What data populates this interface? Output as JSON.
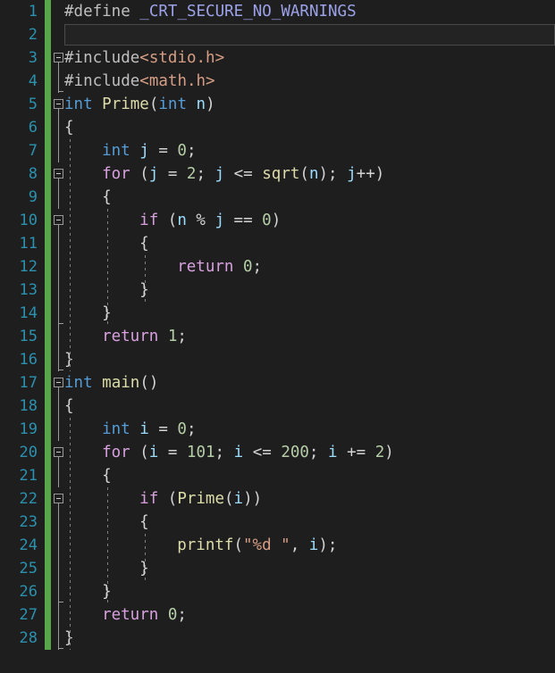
{
  "editor": {
    "name": "code-editor",
    "theme": "dark",
    "language": "c",
    "colors": {
      "background": "#1e1e1e",
      "line_number": "#2b91af",
      "change_bar": "#57a64a",
      "keyword": "#569cd6",
      "control_keyword": "#d8a0df",
      "function": "#dcdcaa",
      "number": "#b5cea8",
      "string": "#d69d85",
      "macro": "#9ca2e8",
      "preprocessor": "#bfbfbf",
      "plain": "#d4d4d4",
      "variable": "#9cdcfe",
      "current_line_border": "#4a4a4a",
      "fold_marker": "#9a9a9a"
    },
    "line_count": 28,
    "current_line": 2,
    "line_numbers": [
      "1",
      "2",
      "3",
      "4",
      "5",
      "6",
      "7",
      "8",
      "9",
      "10",
      "11",
      "12",
      "13",
      "14",
      "15",
      "16",
      "17",
      "18",
      "19",
      "20",
      "21",
      "22",
      "23",
      "24",
      "25",
      "26",
      "27",
      "28"
    ],
    "lines": [
      {
        "n": 1,
        "indent": 0,
        "fold": "none",
        "tokens": [
          {
            "t": "#define ",
            "c": "pp"
          },
          {
            "t": "_CRT_SECURE_NO_WARNINGS",
            "c": "macro"
          }
        ]
      },
      {
        "n": 2,
        "indent": 0,
        "fold": "none",
        "current": true,
        "tokens": []
      },
      {
        "n": 3,
        "indent": 0,
        "fold": "open",
        "tokens": [
          {
            "t": "#include",
            "c": "pp"
          },
          {
            "t": "<stdio.h>",
            "c": "str"
          }
        ]
      },
      {
        "n": 4,
        "indent": 0,
        "fold": "line-end",
        "tokens": [
          {
            "t": "#include",
            "c": "pp"
          },
          {
            "t": "<math.h>",
            "c": "str"
          }
        ]
      },
      {
        "n": 5,
        "indent": 0,
        "fold": "open",
        "tokens": [
          {
            "t": "int",
            "c": "kw"
          },
          {
            "t": " ",
            "c": "plain"
          },
          {
            "t": "Prime",
            "c": "fn"
          },
          {
            "t": "(",
            "c": "punct"
          },
          {
            "t": "int",
            "c": "kw"
          },
          {
            "t": " n",
            "c": "var"
          },
          {
            "t": ")",
            "c": "punct"
          }
        ]
      },
      {
        "n": 6,
        "indent": 0,
        "fold": "line",
        "tokens": [
          {
            "t": "{",
            "c": "plain"
          }
        ]
      },
      {
        "n": 7,
        "indent": 1,
        "fold": "line",
        "tokens": [
          {
            "t": "int",
            "c": "kw"
          },
          {
            "t": " ",
            "c": "plain"
          },
          {
            "t": "j",
            "c": "var"
          },
          {
            "t": " = ",
            "c": "plain"
          },
          {
            "t": "0",
            "c": "num"
          },
          {
            "t": ";",
            "c": "plain"
          }
        ]
      },
      {
        "n": 8,
        "indent": 1,
        "fold": "open",
        "tokens": [
          {
            "t": "for",
            "c": "ctrl"
          },
          {
            "t": " (",
            "c": "plain"
          },
          {
            "t": "j",
            "c": "var"
          },
          {
            "t": " = ",
            "c": "plain"
          },
          {
            "t": "2",
            "c": "num"
          },
          {
            "t": "; ",
            "c": "plain"
          },
          {
            "t": "j",
            "c": "var"
          },
          {
            "t": " <= ",
            "c": "plain"
          },
          {
            "t": "sqrt",
            "c": "fn"
          },
          {
            "t": "(",
            "c": "plain"
          },
          {
            "t": "n",
            "c": "var"
          },
          {
            "t": "); ",
            "c": "plain"
          },
          {
            "t": "j",
            "c": "var"
          },
          {
            "t": "++)",
            "c": "plain"
          }
        ]
      },
      {
        "n": 9,
        "indent": 1,
        "fold": "line",
        "tokens": [
          {
            "t": "{",
            "c": "plain"
          }
        ]
      },
      {
        "n": 10,
        "indent": 2,
        "fold": "open",
        "tokens": [
          {
            "t": "if",
            "c": "ctrl"
          },
          {
            "t": " (",
            "c": "plain"
          },
          {
            "t": "n",
            "c": "var"
          },
          {
            "t": " % ",
            "c": "plain"
          },
          {
            "t": "j",
            "c": "var"
          },
          {
            "t": " == ",
            "c": "plain"
          },
          {
            "t": "0",
            "c": "num"
          },
          {
            "t": ")",
            "c": "plain"
          }
        ]
      },
      {
        "n": 11,
        "indent": 2,
        "fold": "line",
        "tokens": [
          {
            "t": "{",
            "c": "plain"
          }
        ]
      },
      {
        "n": 12,
        "indent": 3,
        "fold": "line",
        "tokens": [
          {
            "t": "return",
            "c": "ctrl"
          },
          {
            "t": " ",
            "c": "plain"
          },
          {
            "t": "0",
            "c": "num"
          },
          {
            "t": ";",
            "c": "plain"
          }
        ]
      },
      {
        "n": 13,
        "indent": 2,
        "fold": "line",
        "tokens": [
          {
            "t": "}",
            "c": "plain"
          }
        ]
      },
      {
        "n": 14,
        "indent": 1,
        "fold": "end",
        "tokens": [
          {
            "t": "}",
            "c": "plain"
          }
        ]
      },
      {
        "n": 15,
        "indent": 1,
        "fold": "line",
        "tokens": [
          {
            "t": "return",
            "c": "ctrl"
          },
          {
            "t": " ",
            "c": "plain"
          },
          {
            "t": "1",
            "c": "num"
          },
          {
            "t": ";",
            "c": "plain"
          }
        ]
      },
      {
        "n": 16,
        "indent": 0,
        "fold": "end",
        "tokens": [
          {
            "t": "}",
            "c": "plain"
          }
        ]
      },
      {
        "n": 17,
        "indent": 0,
        "fold": "open",
        "tokens": [
          {
            "t": "int",
            "c": "kw"
          },
          {
            "t": " ",
            "c": "plain"
          },
          {
            "t": "main",
            "c": "fn"
          },
          {
            "t": "()",
            "c": "punct"
          }
        ]
      },
      {
        "n": 18,
        "indent": 0,
        "fold": "line",
        "tokens": [
          {
            "t": "{",
            "c": "plain"
          }
        ]
      },
      {
        "n": 19,
        "indent": 1,
        "fold": "line",
        "tokens": [
          {
            "t": "int",
            "c": "kw"
          },
          {
            "t": " ",
            "c": "plain"
          },
          {
            "t": "i",
            "c": "var"
          },
          {
            "t": " = ",
            "c": "plain"
          },
          {
            "t": "0",
            "c": "num"
          },
          {
            "t": ";",
            "c": "plain"
          }
        ]
      },
      {
        "n": 20,
        "indent": 1,
        "fold": "open",
        "tokens": [
          {
            "t": "for",
            "c": "ctrl"
          },
          {
            "t": " (",
            "c": "plain"
          },
          {
            "t": "i",
            "c": "var"
          },
          {
            "t": " = ",
            "c": "plain"
          },
          {
            "t": "101",
            "c": "num"
          },
          {
            "t": "; ",
            "c": "plain"
          },
          {
            "t": "i",
            "c": "var"
          },
          {
            "t": " <= ",
            "c": "plain"
          },
          {
            "t": "200",
            "c": "num"
          },
          {
            "t": "; ",
            "c": "plain"
          },
          {
            "t": "i",
            "c": "var"
          },
          {
            "t": " += ",
            "c": "plain"
          },
          {
            "t": "2",
            "c": "num"
          },
          {
            "t": ")",
            "c": "plain"
          }
        ]
      },
      {
        "n": 21,
        "indent": 1,
        "fold": "line",
        "tokens": [
          {
            "t": "{",
            "c": "plain"
          }
        ]
      },
      {
        "n": 22,
        "indent": 2,
        "fold": "open",
        "tokens": [
          {
            "t": "if",
            "c": "ctrl"
          },
          {
            "t": " (",
            "c": "plain"
          },
          {
            "t": "Prime",
            "c": "fn"
          },
          {
            "t": "(",
            "c": "plain"
          },
          {
            "t": "i",
            "c": "var"
          },
          {
            "t": "))",
            "c": "plain"
          }
        ]
      },
      {
        "n": 23,
        "indent": 2,
        "fold": "line",
        "tokens": [
          {
            "t": "{",
            "c": "plain"
          }
        ]
      },
      {
        "n": 24,
        "indent": 3,
        "fold": "line",
        "tokens": [
          {
            "t": "printf",
            "c": "fn"
          },
          {
            "t": "(",
            "c": "plain"
          },
          {
            "t": "\"%d \"",
            "c": "str"
          },
          {
            "t": ", ",
            "c": "plain"
          },
          {
            "t": "i",
            "c": "var"
          },
          {
            "t": ");",
            "c": "plain"
          }
        ]
      },
      {
        "n": 25,
        "indent": 2,
        "fold": "line",
        "tokens": [
          {
            "t": "}",
            "c": "plain"
          }
        ]
      },
      {
        "n": 26,
        "indent": 1,
        "fold": "end",
        "tokens": [
          {
            "t": "}",
            "c": "plain"
          }
        ]
      },
      {
        "n": 27,
        "indent": 1,
        "fold": "line",
        "tokens": [
          {
            "t": "return",
            "c": "ctrl"
          },
          {
            "t": " ",
            "c": "plain"
          },
          {
            "t": "0",
            "c": "num"
          },
          {
            "t": ";",
            "c": "plain"
          }
        ]
      },
      {
        "n": 28,
        "indent": 0,
        "fold": "end",
        "tokens": [
          {
            "t": "}",
            "c": "plain"
          }
        ]
      }
    ]
  }
}
